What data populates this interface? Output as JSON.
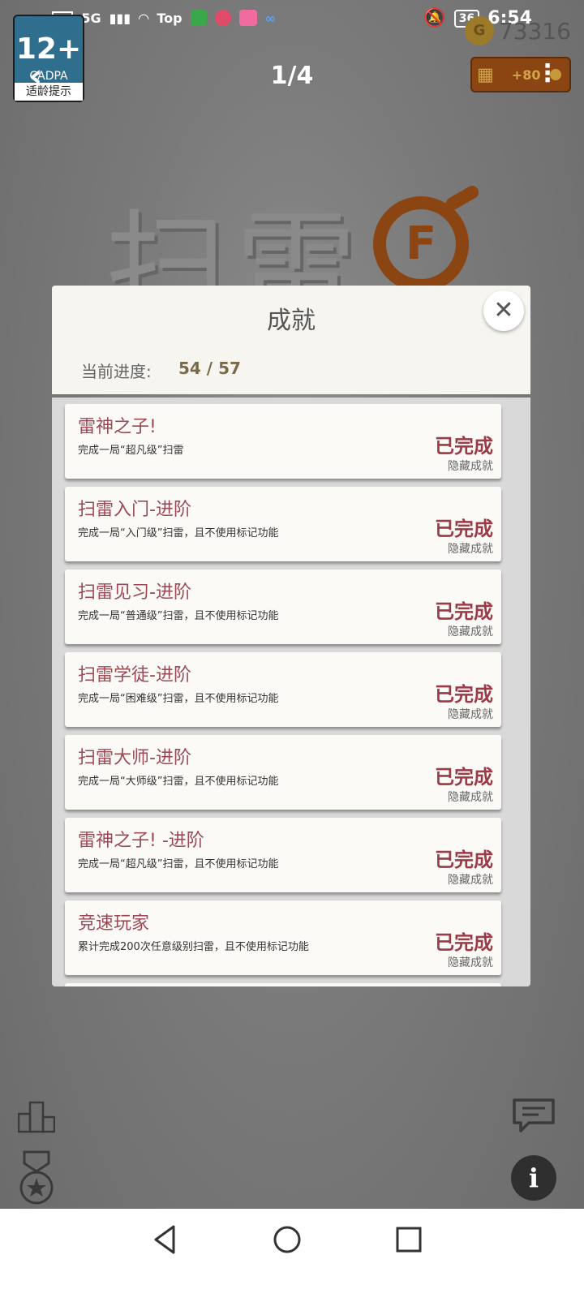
{
  "status_bar": {
    "hd": "HD",
    "network": "5G",
    "top_app": "Top",
    "battery": "36",
    "time": "6:54"
  },
  "header": {
    "age_badge_number": "12+",
    "age_badge_org": "CADPA",
    "age_badge_caption": "适龄提示",
    "page_counter": "1/4",
    "coins": "73316",
    "video_reward": "+80"
  },
  "logo": {
    "text": "扫雷",
    "bomb_letter": "F"
  },
  "modal": {
    "title": "成就",
    "progress_label": "当前进度:",
    "progress_value": "54 / 57",
    "achievements": [
      {
        "title": "雷神之子!",
        "desc": "完成一局“超凡级”扫雷",
        "status": "已完成",
        "tag": "隐藏成就"
      },
      {
        "title": "扫雷入门-进阶",
        "desc": "完成一局“入门级”扫雷，且不使用标记功能",
        "status": "已完成",
        "tag": "隐藏成就"
      },
      {
        "title": "扫雷见习-进阶",
        "desc": "完成一局“普通级”扫雷，且不使用标记功能",
        "status": "已完成",
        "tag": "隐藏成就"
      },
      {
        "title": "扫雷学徒-进阶",
        "desc": "完成一局“困难级”扫雷，且不使用标记功能",
        "status": "已完成",
        "tag": "隐藏成就"
      },
      {
        "title": "扫雷大师-进阶",
        "desc": "完成一局“大师级”扫雷，且不使用标记功能",
        "status": "已完成",
        "tag": "隐藏成就"
      },
      {
        "title": "雷神之子! -进阶",
        "desc": "完成一局“超凡级”扫雷，且不使用标记功能",
        "status": "已完成",
        "tag": "隐藏成就"
      },
      {
        "title": "竞速玩家",
        "desc": "累计完成200次任意级别扫雷，且不使用标记功能",
        "status": "已完成",
        "tag": "隐藏成就"
      }
    ]
  },
  "bottom": {
    "info_glyph": "i"
  }
}
